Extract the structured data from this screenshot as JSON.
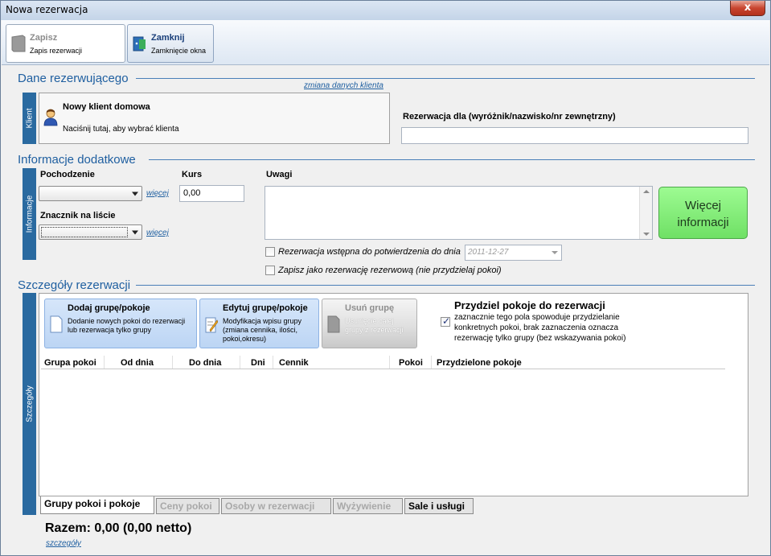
{
  "window": {
    "title": "Nowa rezerwacja",
    "close_glyph": "x"
  },
  "toolbar": {
    "save": {
      "title": "Zapisz",
      "subtitle": "Zapis rezerwacji",
      "icon": "save-icon"
    },
    "close": {
      "title": "Zamknij",
      "subtitle": "Zamknięcie okna",
      "icon": "exit-icon"
    }
  },
  "booker": {
    "section_title": "Dane rezerwującego",
    "change_link": "zmiana danych klienta",
    "side_label": "Klient",
    "client_name": "Nowy klient domowa",
    "client_hint": "Naciśnij tutaj, aby wybrać klienta",
    "reservation_for_label": "Rezerwacja dla (wyróżnik/nazwisko/nr zewnętrzny)",
    "reservation_for_value": ""
  },
  "extra": {
    "section_title": "Informacje dodatkowe",
    "side_label": "Informacje",
    "origin_label": "Pochodzenie",
    "origin_value": "",
    "origin_more": "więcej",
    "rate_label": "Kurs",
    "rate_value": "0,00",
    "marker_label": "Znacznik na liście",
    "marker_value": "",
    "marker_more": "więcej",
    "notes_label": "Uwagi",
    "notes_value": "",
    "more_info_line1": "Więcej",
    "more_info_line2": "informacji",
    "prelim_label": "Rezerwacja wstępna do potwierdzenia do dnia",
    "prelim_checked": false,
    "prelim_date": "2011-12-27",
    "reserve_label": "Zapisz jako rezerwację rezerwową (nie przydzielaj pokoi)",
    "reserve_checked": false
  },
  "details": {
    "section_title": "Szczegóły rezerwacji",
    "side_label": "Szczegóły",
    "add_btn": {
      "title": "Dodaj grupę/pokoje",
      "line1": "Dodanie nowych pokoi do rezerwacji",
      "line2": "lub rezerwacja tylko grupy"
    },
    "edit_btn": {
      "title": "Edytuj grupę/pokoje",
      "line1": "Modyfikacja wpisu grupy",
      "line2": "(zmiana cennika, ilości,",
      "line3": "pokoi,okresu)"
    },
    "remove_btn": {
      "title": "Usuń grupę",
      "line1": "Usunięcie całej",
      "line2": "grupy z rezerwacji"
    },
    "assign_title": "Przydziel pokoje do rezerwacji",
    "assign_checked": true,
    "assign_line1": "zaznacznie tego pola spowoduje przydzielanie",
    "assign_line2": "konkretnych pokoi, brak zaznaczenia oznacza",
    "assign_line3": "rezerwację tylko grupy (bez wskazywania pokoi)",
    "columns": [
      "Grupa pokoi",
      "Od dnia",
      "Do dnia",
      "Dni",
      "Cennik",
      "Pokoi",
      "Przydzielone pokoje"
    ],
    "tabs": [
      "Grupy pokoi i pokoje",
      "Ceny pokoi",
      "Osoby w rezerwacji",
      "Wyżywienie",
      "Sale i usługi"
    ]
  },
  "footer": {
    "total": "Razem: 0,00 (0,00 netto)",
    "details_link": "szczegóły"
  },
  "colors": {
    "accent": "#1f5fa0",
    "side_tab": "#2a6aa0",
    "more_info_bg": "#7ff074"
  }
}
